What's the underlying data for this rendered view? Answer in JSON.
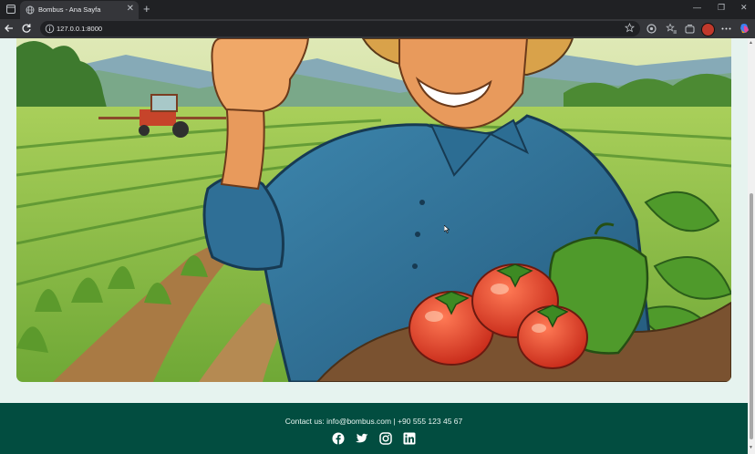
{
  "browser": {
    "tab_title": "Bombus - Ana Sayfa",
    "tab_close": "✕",
    "new_tab": "+",
    "url": "127.0.0.1:8000",
    "window_controls": [
      "—",
      "❐",
      "✕"
    ]
  },
  "footer": {
    "contact_label": "Contact us:",
    "email": "info@bombus.com",
    "separator": "|",
    "phone": "+90 555 123 45 67",
    "social_icons": [
      "facebook-icon",
      "twitter-icon",
      "instagram-icon",
      "linkedin-icon"
    ]
  },
  "colors": {
    "footer_bg": "#024d40",
    "page_bg": "#e6f3ef",
    "shirt": "#2f6f96",
    "tomato": "#d9331f",
    "pepper": "#4f9a2b"
  }
}
